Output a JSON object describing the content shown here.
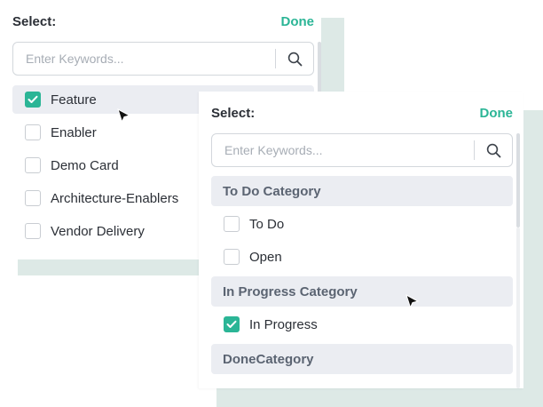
{
  "back_dropdown": {
    "title": "Select:",
    "done": "Done",
    "search_placeholder": "Enter Keywords...",
    "items": [
      {
        "label": "Feature",
        "checked": true
      },
      {
        "label": "Enabler",
        "checked": false
      },
      {
        "label": "Demo Card",
        "checked": false
      },
      {
        "label": "Architecture-Enablers",
        "checked": false
      },
      {
        "label": "Vendor Delivery",
        "checked": false
      }
    ]
  },
  "front_dropdown": {
    "title": "Select:",
    "done": "Done",
    "search_placeholder": "Enter Keywords...",
    "groups": [
      {
        "category": "To Do Category",
        "items": [
          {
            "label": "To Do",
            "checked": false
          },
          {
            "label": "Open",
            "checked": false
          }
        ]
      },
      {
        "category": "In Progress Category",
        "items": [
          {
            "label": "In Progress",
            "checked": true
          }
        ]
      },
      {
        "category": "DoneCategory",
        "items": []
      }
    ]
  },
  "colors": {
    "accent": "#2bb596",
    "category_bg": "#ebedf2",
    "backdrop": "#dde9e6"
  },
  "icons": [
    "search-icon",
    "check-icon",
    "mouse-cursor-icon"
  ]
}
